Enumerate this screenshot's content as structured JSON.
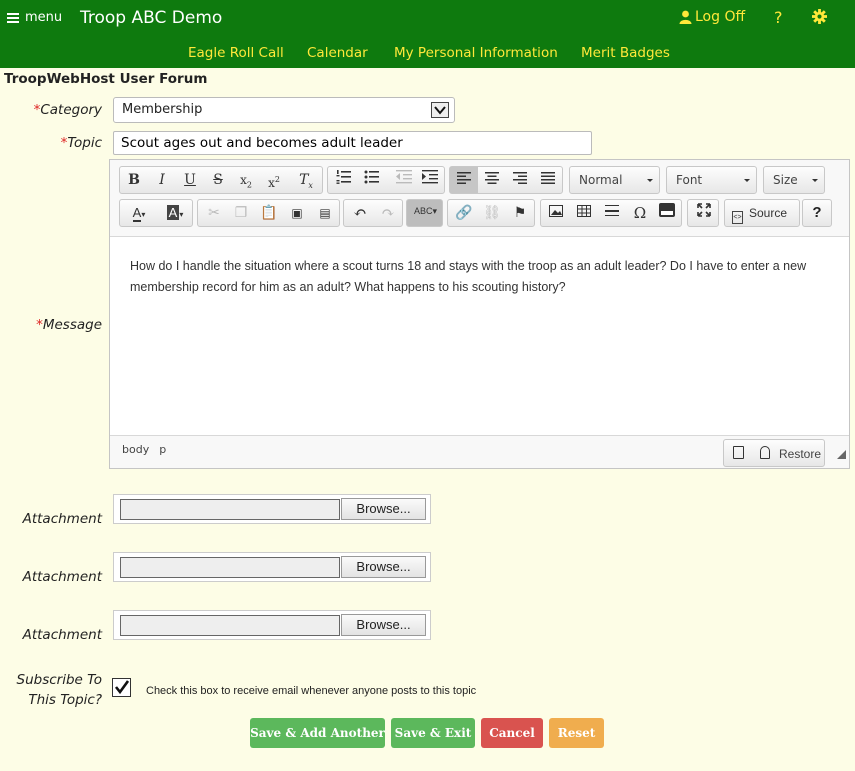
{
  "header": {
    "menu_label": "menu",
    "title": "Troop ABC Demo",
    "logoff_label": "Log Off",
    "help_label": "?",
    "nav": [
      "Eagle Roll Call",
      "Calendar",
      "My Personal Information",
      "Merit Badges"
    ]
  },
  "forum_title": "TroopWebHost User Forum",
  "form": {
    "required_mark": "*",
    "category_label": "Category",
    "category_value": "Membership",
    "topic_label": "Topic",
    "topic_value": "Scout ages out and becomes adult leader",
    "message_label": "Message",
    "message_text": "How do I handle the situation where a scout turns 18 and stays with the troop as an adult leader?   Do I have to enter a new membership record for him as an adult?   What happens to his scouting history?",
    "attachment_label": "Attachment",
    "browse_label": "Browse...",
    "subscribe_label_line1": "Subscribe To",
    "subscribe_label_line2": "This Topic?",
    "subscribe_checked": true,
    "subscribe_hint": "Check this box to receive email whenever anyone posts to this topic"
  },
  "editor": {
    "format_combo": "Normal",
    "font_combo": "Font",
    "size_combo": "Size",
    "source_label": "Source",
    "help_label": "?",
    "path": [
      "body",
      "p"
    ],
    "restore_label": "Restore"
  },
  "buttons": {
    "save_add": "Save & Add Another",
    "save_exit": "Save & Exit",
    "cancel": "Cancel",
    "reset": "Reset"
  },
  "colors": {
    "header_bg": "#0e7a0e",
    "nav_text": "#ffe83a",
    "save_green": "#5cb85c",
    "cancel_red": "#d9534f",
    "reset_orange": "#f0ad4e"
  }
}
